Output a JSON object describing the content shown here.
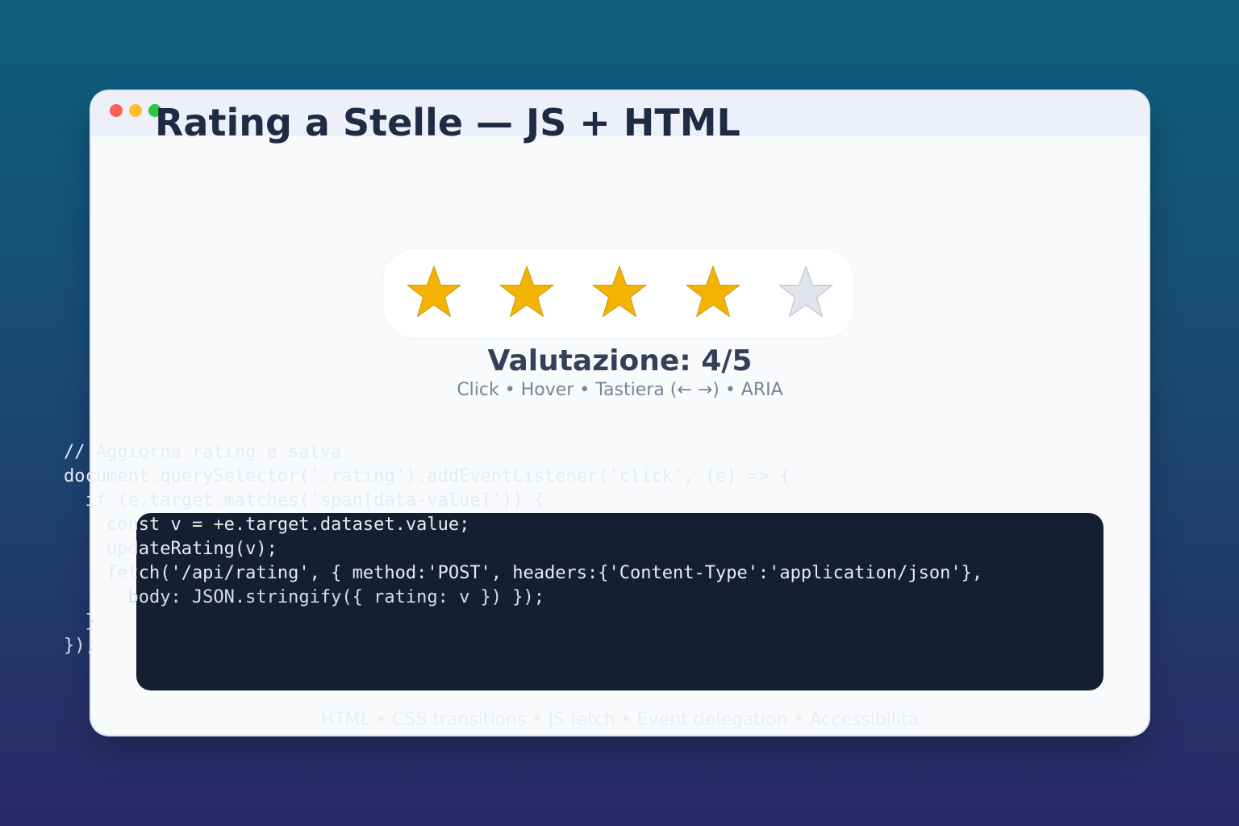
{
  "window": {
    "title": "Rating a Stelle — JS + HTML",
    "controls": [
      "close",
      "minimize",
      "maximize"
    ]
  },
  "rating": {
    "value": 4,
    "max": 5,
    "filled_color": "#f5b301",
    "empty_color": "#e1e4ea",
    "label": "Valutazione: 4/5",
    "hint": "Click • Hover • Tastiera (← →) • ARIA"
  },
  "code": {
    "lines": [
      "// Aggiorna rating e salva",
      "document.querySelector('.rating').addEventListener('click', (e) => {",
      "  if (e.target.matches('span[data-value]')) {",
      "    const v = +e.target.dataset.value;",
      "    updateRating(v);",
      "    fetch('/api/rating', { method:'POST', headers:{'Content-Type':'application/json'},",
      "      body: JSON.stringify({ rating: v }) });",
      "  }",
      "});"
    ]
  },
  "footer": {
    "text": "HTML • CSS transitions • JS fetch • Event delegation • Accessibilità"
  }
}
